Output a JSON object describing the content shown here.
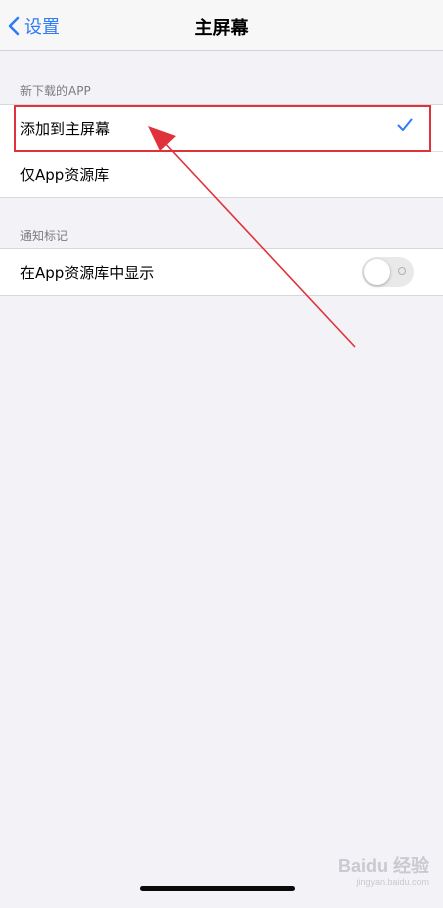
{
  "nav": {
    "back_label": "设置",
    "title": "主屏幕"
  },
  "sections": [
    {
      "header": "新下载的APP",
      "options": [
        {
          "label": "添加到主屏幕",
          "selected": true
        },
        {
          "label": "仅App资源库",
          "selected": false
        }
      ]
    },
    {
      "header": "通知标记",
      "toggle": {
        "label": "在App资源库中显示",
        "on": false
      }
    }
  ],
  "colors": {
    "accent": "#2f7cf6",
    "annotation": "#e0323a",
    "background": "#f2f2f7"
  },
  "watermark": {
    "main": "Baidu 经验",
    "sub": "jingyan.baidu.com"
  }
}
